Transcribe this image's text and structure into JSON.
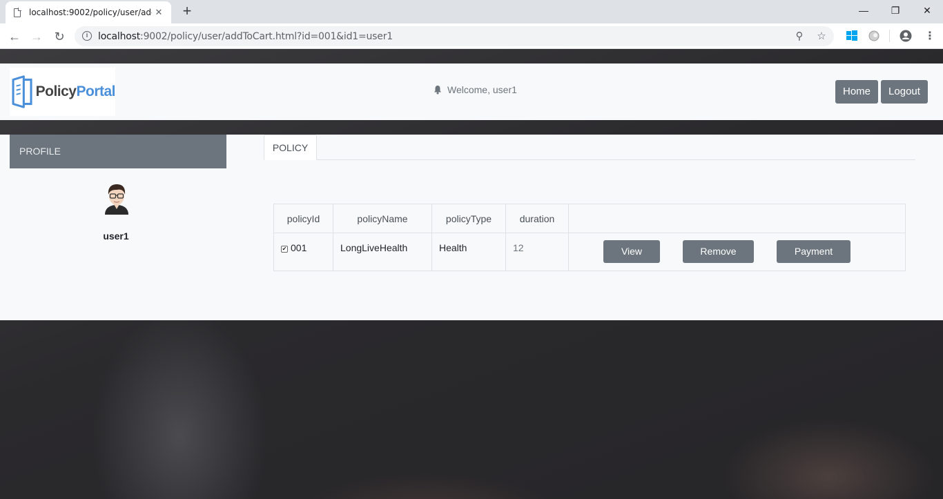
{
  "browser": {
    "tab_title": "localhost:9002/policy/user/addToCart.html?id=001&id1=user1",
    "url_host": "localhost",
    "url_rest": ":9002/policy/user/addToCart.html?id=001&id1=user1",
    "new_tab_label": "+",
    "close_tab_label": "✕"
  },
  "header": {
    "logo_text_main": "Policy",
    "logo_text_accent": "Portal",
    "welcome_text": "Welcome, user1",
    "home_label": "Home",
    "logout_label": "Logout"
  },
  "profile": {
    "heading": "PROFILE",
    "username": "user1"
  },
  "tabs": [
    {
      "label": "POLICY"
    }
  ],
  "policy_table": {
    "columns": [
      "policyId",
      "policyName",
      "policyType",
      "duration"
    ],
    "rows": [
      {
        "policyId": "001",
        "policyName": "LongLiveHealth",
        "policyType": "Health",
        "duration": "12",
        "checked": true
      }
    ],
    "actions": {
      "view_label": "View",
      "remove_label": "Remove",
      "payment_label": "Payment"
    }
  },
  "colors": {
    "button_gray": "#6c757d",
    "panel_bg": "#f8f9fa",
    "logo_accent": "#4a8fd9"
  }
}
